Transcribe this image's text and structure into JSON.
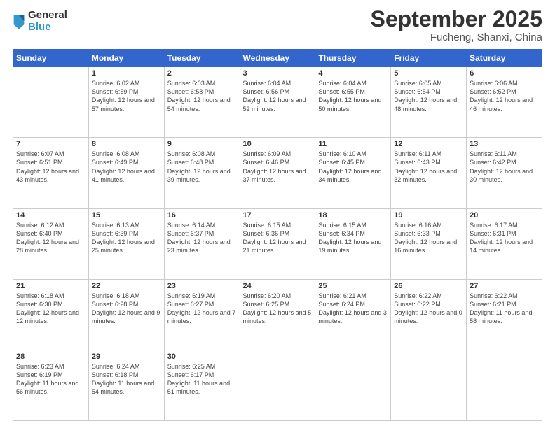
{
  "logo": {
    "general": "General",
    "blue": "Blue"
  },
  "title": "September 2025",
  "location": "Fucheng, Shanxi, China",
  "days_of_week": [
    "Sunday",
    "Monday",
    "Tuesday",
    "Wednesday",
    "Thursday",
    "Friday",
    "Saturday"
  ],
  "weeks": [
    [
      {
        "day": "",
        "sunrise": "",
        "sunset": "",
        "daylight": ""
      },
      {
        "day": "1",
        "sunrise": "Sunrise: 6:02 AM",
        "sunset": "Sunset: 6:59 PM",
        "daylight": "Daylight: 12 hours and 57 minutes."
      },
      {
        "day": "2",
        "sunrise": "Sunrise: 6:03 AM",
        "sunset": "Sunset: 6:58 PM",
        "daylight": "Daylight: 12 hours and 54 minutes."
      },
      {
        "day": "3",
        "sunrise": "Sunrise: 6:04 AM",
        "sunset": "Sunset: 6:56 PM",
        "daylight": "Daylight: 12 hours and 52 minutes."
      },
      {
        "day": "4",
        "sunrise": "Sunrise: 6:04 AM",
        "sunset": "Sunset: 6:55 PM",
        "daylight": "Daylight: 12 hours and 50 minutes."
      },
      {
        "day": "5",
        "sunrise": "Sunrise: 6:05 AM",
        "sunset": "Sunset: 6:54 PM",
        "daylight": "Daylight: 12 hours and 48 minutes."
      },
      {
        "day": "6",
        "sunrise": "Sunrise: 6:06 AM",
        "sunset": "Sunset: 6:52 PM",
        "daylight": "Daylight: 12 hours and 46 minutes."
      }
    ],
    [
      {
        "day": "7",
        "sunrise": "Sunrise: 6:07 AM",
        "sunset": "Sunset: 6:51 PM",
        "daylight": "Daylight: 12 hours and 43 minutes."
      },
      {
        "day": "8",
        "sunrise": "Sunrise: 6:08 AM",
        "sunset": "Sunset: 6:49 PM",
        "daylight": "Daylight: 12 hours and 41 minutes."
      },
      {
        "day": "9",
        "sunrise": "Sunrise: 6:08 AM",
        "sunset": "Sunset: 6:48 PM",
        "daylight": "Daylight: 12 hours and 39 minutes."
      },
      {
        "day": "10",
        "sunrise": "Sunrise: 6:09 AM",
        "sunset": "Sunset: 6:46 PM",
        "daylight": "Daylight: 12 hours and 37 minutes."
      },
      {
        "day": "11",
        "sunrise": "Sunrise: 6:10 AM",
        "sunset": "Sunset: 6:45 PM",
        "daylight": "Daylight: 12 hours and 34 minutes."
      },
      {
        "day": "12",
        "sunrise": "Sunrise: 6:11 AM",
        "sunset": "Sunset: 6:43 PM",
        "daylight": "Daylight: 12 hours and 32 minutes."
      },
      {
        "day": "13",
        "sunrise": "Sunrise: 6:11 AM",
        "sunset": "Sunset: 6:42 PM",
        "daylight": "Daylight: 12 hours and 30 minutes."
      }
    ],
    [
      {
        "day": "14",
        "sunrise": "Sunrise: 6:12 AM",
        "sunset": "Sunset: 6:40 PM",
        "daylight": "Daylight: 12 hours and 28 minutes."
      },
      {
        "day": "15",
        "sunrise": "Sunrise: 6:13 AM",
        "sunset": "Sunset: 6:39 PM",
        "daylight": "Daylight: 12 hours and 25 minutes."
      },
      {
        "day": "16",
        "sunrise": "Sunrise: 6:14 AM",
        "sunset": "Sunset: 6:37 PM",
        "daylight": "Daylight: 12 hours and 23 minutes."
      },
      {
        "day": "17",
        "sunrise": "Sunrise: 6:15 AM",
        "sunset": "Sunset: 6:36 PM",
        "daylight": "Daylight: 12 hours and 21 minutes."
      },
      {
        "day": "18",
        "sunrise": "Sunrise: 6:15 AM",
        "sunset": "Sunset: 6:34 PM",
        "daylight": "Daylight: 12 hours and 19 minutes."
      },
      {
        "day": "19",
        "sunrise": "Sunrise: 6:16 AM",
        "sunset": "Sunset: 6:33 PM",
        "daylight": "Daylight: 12 hours and 16 minutes."
      },
      {
        "day": "20",
        "sunrise": "Sunrise: 6:17 AM",
        "sunset": "Sunset: 6:31 PM",
        "daylight": "Daylight: 12 hours and 14 minutes."
      }
    ],
    [
      {
        "day": "21",
        "sunrise": "Sunrise: 6:18 AM",
        "sunset": "Sunset: 6:30 PM",
        "daylight": "Daylight: 12 hours and 12 minutes."
      },
      {
        "day": "22",
        "sunrise": "Sunrise: 6:18 AM",
        "sunset": "Sunset: 6:28 PM",
        "daylight": "Daylight: 12 hours and 9 minutes."
      },
      {
        "day": "23",
        "sunrise": "Sunrise: 6:19 AM",
        "sunset": "Sunset: 6:27 PM",
        "daylight": "Daylight: 12 hours and 7 minutes."
      },
      {
        "day": "24",
        "sunrise": "Sunrise: 6:20 AM",
        "sunset": "Sunset: 6:25 PM",
        "daylight": "Daylight: 12 hours and 5 minutes."
      },
      {
        "day": "25",
        "sunrise": "Sunrise: 6:21 AM",
        "sunset": "Sunset: 6:24 PM",
        "daylight": "Daylight: 12 hours and 3 minutes."
      },
      {
        "day": "26",
        "sunrise": "Sunrise: 6:22 AM",
        "sunset": "Sunset: 6:22 PM",
        "daylight": "Daylight: 12 hours and 0 minutes."
      },
      {
        "day": "27",
        "sunrise": "Sunrise: 6:22 AM",
        "sunset": "Sunset: 6:21 PM",
        "daylight": "Daylight: 11 hours and 58 minutes."
      }
    ],
    [
      {
        "day": "28",
        "sunrise": "Sunrise: 6:23 AM",
        "sunset": "Sunset: 6:19 PM",
        "daylight": "Daylight: 11 hours and 56 minutes."
      },
      {
        "day": "29",
        "sunrise": "Sunrise: 6:24 AM",
        "sunset": "Sunset: 6:18 PM",
        "daylight": "Daylight: 11 hours and 54 minutes."
      },
      {
        "day": "30",
        "sunrise": "Sunrise: 6:25 AM",
        "sunset": "Sunset: 6:17 PM",
        "daylight": "Daylight: 11 hours and 51 minutes."
      },
      {
        "day": "",
        "sunrise": "",
        "sunset": "",
        "daylight": ""
      },
      {
        "day": "",
        "sunrise": "",
        "sunset": "",
        "daylight": ""
      },
      {
        "day": "",
        "sunrise": "",
        "sunset": "",
        "daylight": ""
      },
      {
        "day": "",
        "sunrise": "",
        "sunset": "",
        "daylight": ""
      }
    ]
  ]
}
